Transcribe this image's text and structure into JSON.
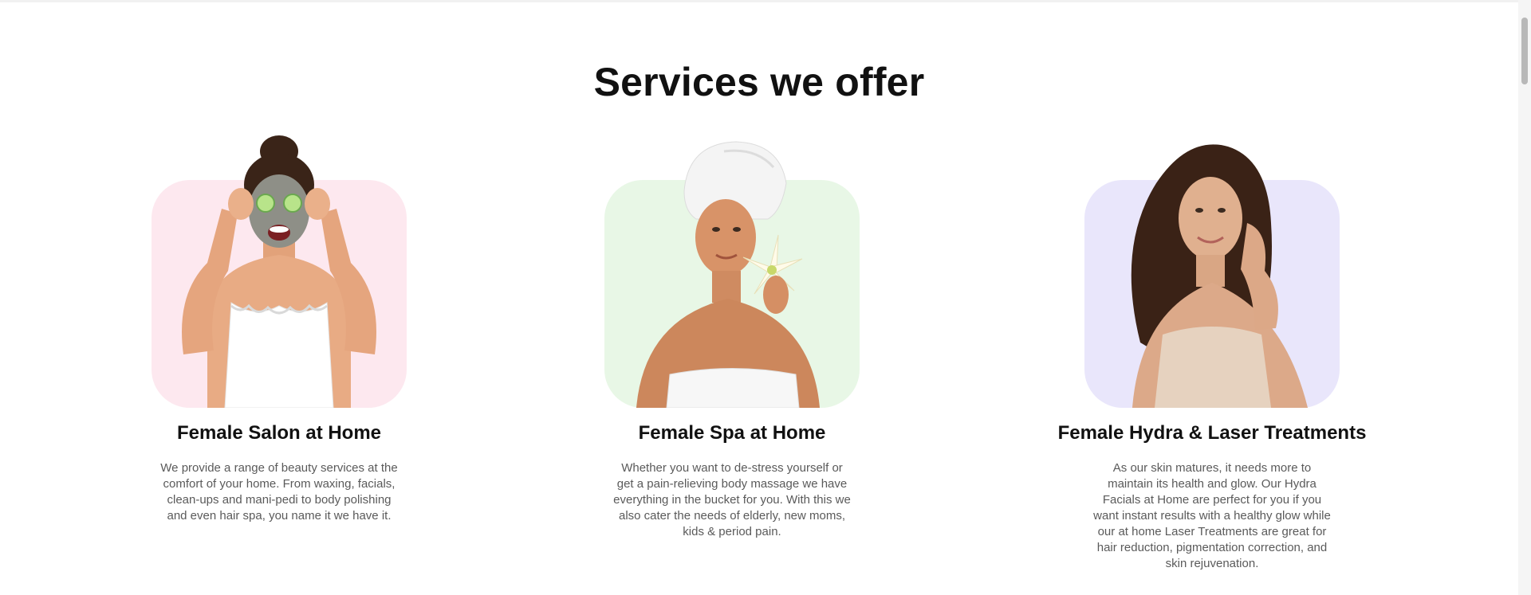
{
  "section_title": "Services we offer",
  "colors": {
    "pink_panel": "#fde8ef",
    "green_panel": "#e8f7e6",
    "lavender_panel": "#e9e6fb"
  },
  "services": [
    {
      "title": "Female Salon at Home",
      "description": "We provide a range of beauty services at the comfort of your home. From waxing, facials, clean-ups and mani-pedi to body polishing and even hair spa, you name it we have it.",
      "image_icon": "woman-face-mask-cucumber-icon"
    },
    {
      "title": "Female Spa at Home",
      "description": "Whether you want to de-stress yourself or get a pain-relieving body massage we have everything in the bucket for you. With this we also cater the needs of elderly, new moms, kids & period pain.",
      "image_icon": "woman-towel-lily-icon"
    },
    {
      "title": "Female Hydra & Laser Treatments",
      "description": "As our skin matures, it needs more to maintain its health and glow. Our Hydra Facials at Home are perfect for you if you want instant results with a healthy glow while our at home Laser Treatments are great for hair reduction, pigmentation correction, and skin rejuvenation.",
      "image_icon": "woman-long-hair-icon"
    }
  ]
}
